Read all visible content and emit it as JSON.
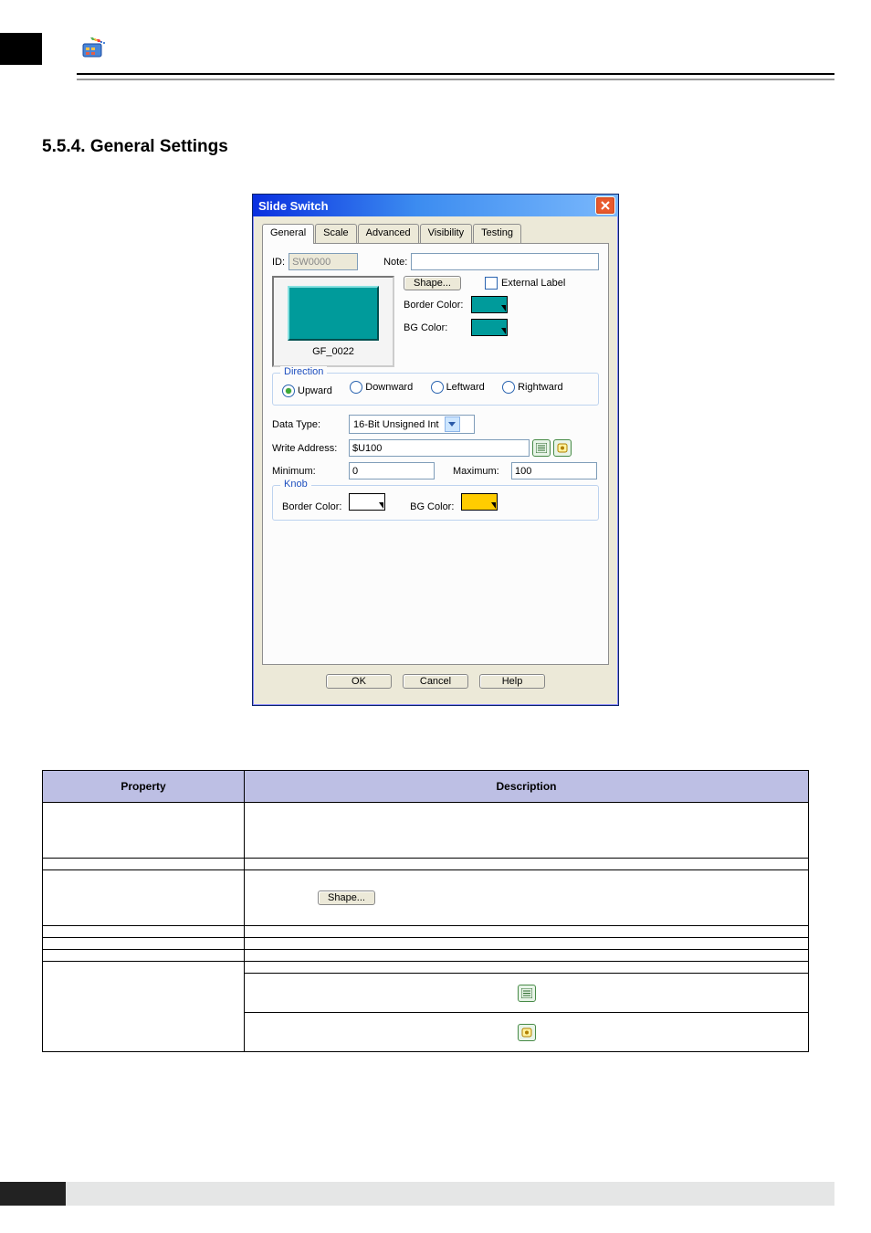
{
  "section_heading": "5.5.4. General Settings",
  "dialog": {
    "title": "Slide Switch",
    "tabs": [
      "General",
      "Scale",
      "Advanced",
      "Visibility",
      "Testing"
    ],
    "active_tab": 0,
    "id_label": "ID:",
    "id_value": "SW0000",
    "note_label": "Note:",
    "note_value": "",
    "shape_name": "GF_0022",
    "shape_btn": "Shape...",
    "external_label": "External Label",
    "border_color_label": "Border Color:",
    "bg_color_label": "BG Color:",
    "direction_title": "Direction",
    "direction_options": [
      "Upward",
      "Downward",
      "Leftward",
      "Rightward"
    ],
    "direction_selected": 0,
    "data_type_label": "Data Type:",
    "data_type_value": "16-Bit Unsigned Int",
    "write_addr_label": "Write Address:",
    "write_addr_value": "$U100",
    "min_label": "Minimum:",
    "min_value": "0",
    "max_label": "Maximum:",
    "max_value": "100",
    "knob_title": "Knob",
    "knob_border_label": "Border Color:",
    "knob_bg_label": "BG Color:",
    "colors": {
      "border": "#009b9b",
      "bg": "#009b9b",
      "knob_border": "#ffffff",
      "knob_bg": "#ffcc00"
    },
    "buttons": {
      "ok": "OK",
      "cancel": "Cancel",
      "help": "Help"
    }
  },
  "table": {
    "headers": [
      "Property",
      "Description"
    ],
    "shape_btn_label": "Shape..."
  }
}
